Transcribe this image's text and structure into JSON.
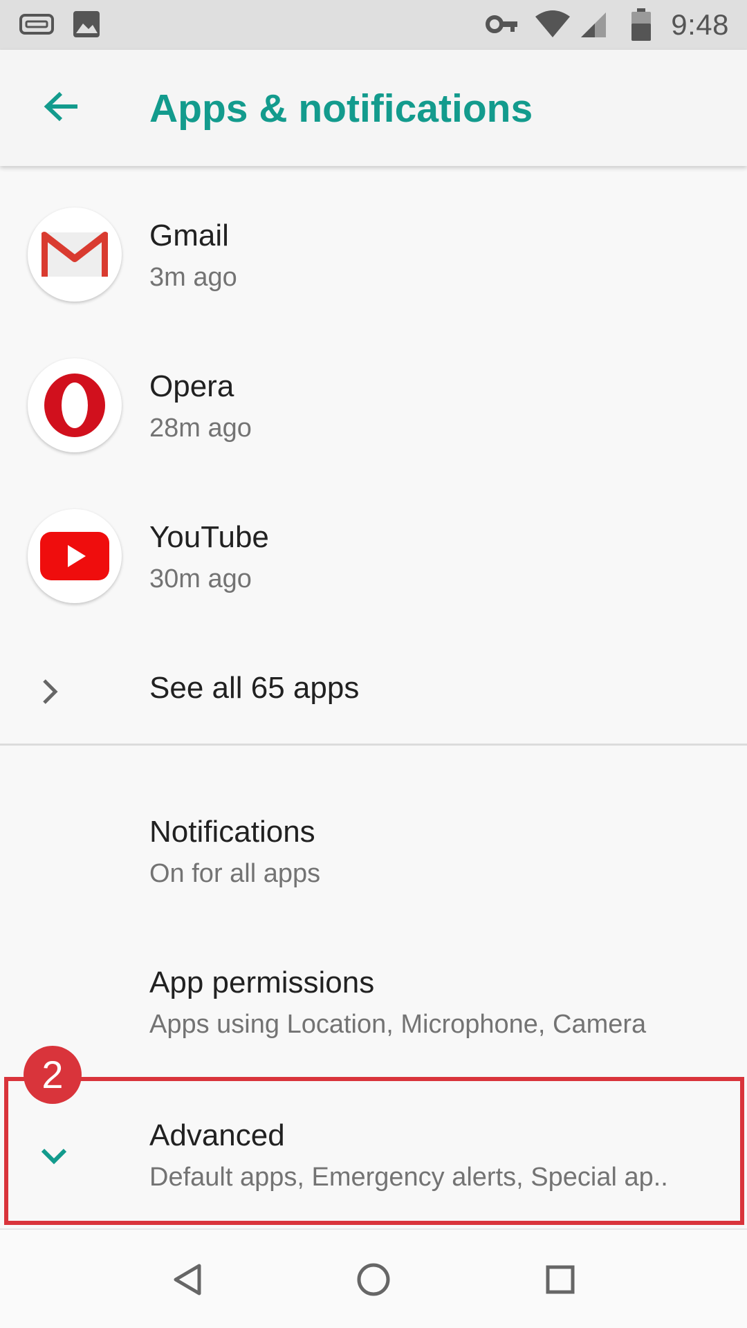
{
  "status_bar": {
    "time": "9:48",
    "icons": [
      "keyboard-icon",
      "image-icon",
      "vpn-key-icon",
      "wifi-icon",
      "signal-icon",
      "battery-icon"
    ]
  },
  "app_bar": {
    "title": "Apps & notifications",
    "back_icon": "arrow-back-icon",
    "accent_color": "#139b8d"
  },
  "recent_apps": [
    {
      "name": "Gmail",
      "time": "3m ago",
      "icon": "gmail-icon"
    },
    {
      "name": "Opera",
      "time": "28m ago",
      "icon": "opera-icon"
    },
    {
      "name": "YouTube",
      "time": "30m ago",
      "icon": "youtube-icon"
    }
  ],
  "see_all": {
    "label": "See all 65 apps",
    "icon": "chevron-right-icon"
  },
  "settings": [
    {
      "title": "Notifications",
      "subtitle": "On for all apps"
    },
    {
      "title": "App permissions",
      "subtitle": "Apps using Location, Microphone, Camera"
    }
  ],
  "advanced": {
    "title": "Advanced",
    "subtitle": "Default apps, Emergency alerts, Special ap..",
    "icon": "chevron-down-icon"
  },
  "annotation": {
    "badge": "2",
    "color": "#d9343b"
  },
  "nav_bar": {
    "icons": [
      "back-triangle-icon",
      "home-circle-icon",
      "recents-square-icon"
    ]
  }
}
